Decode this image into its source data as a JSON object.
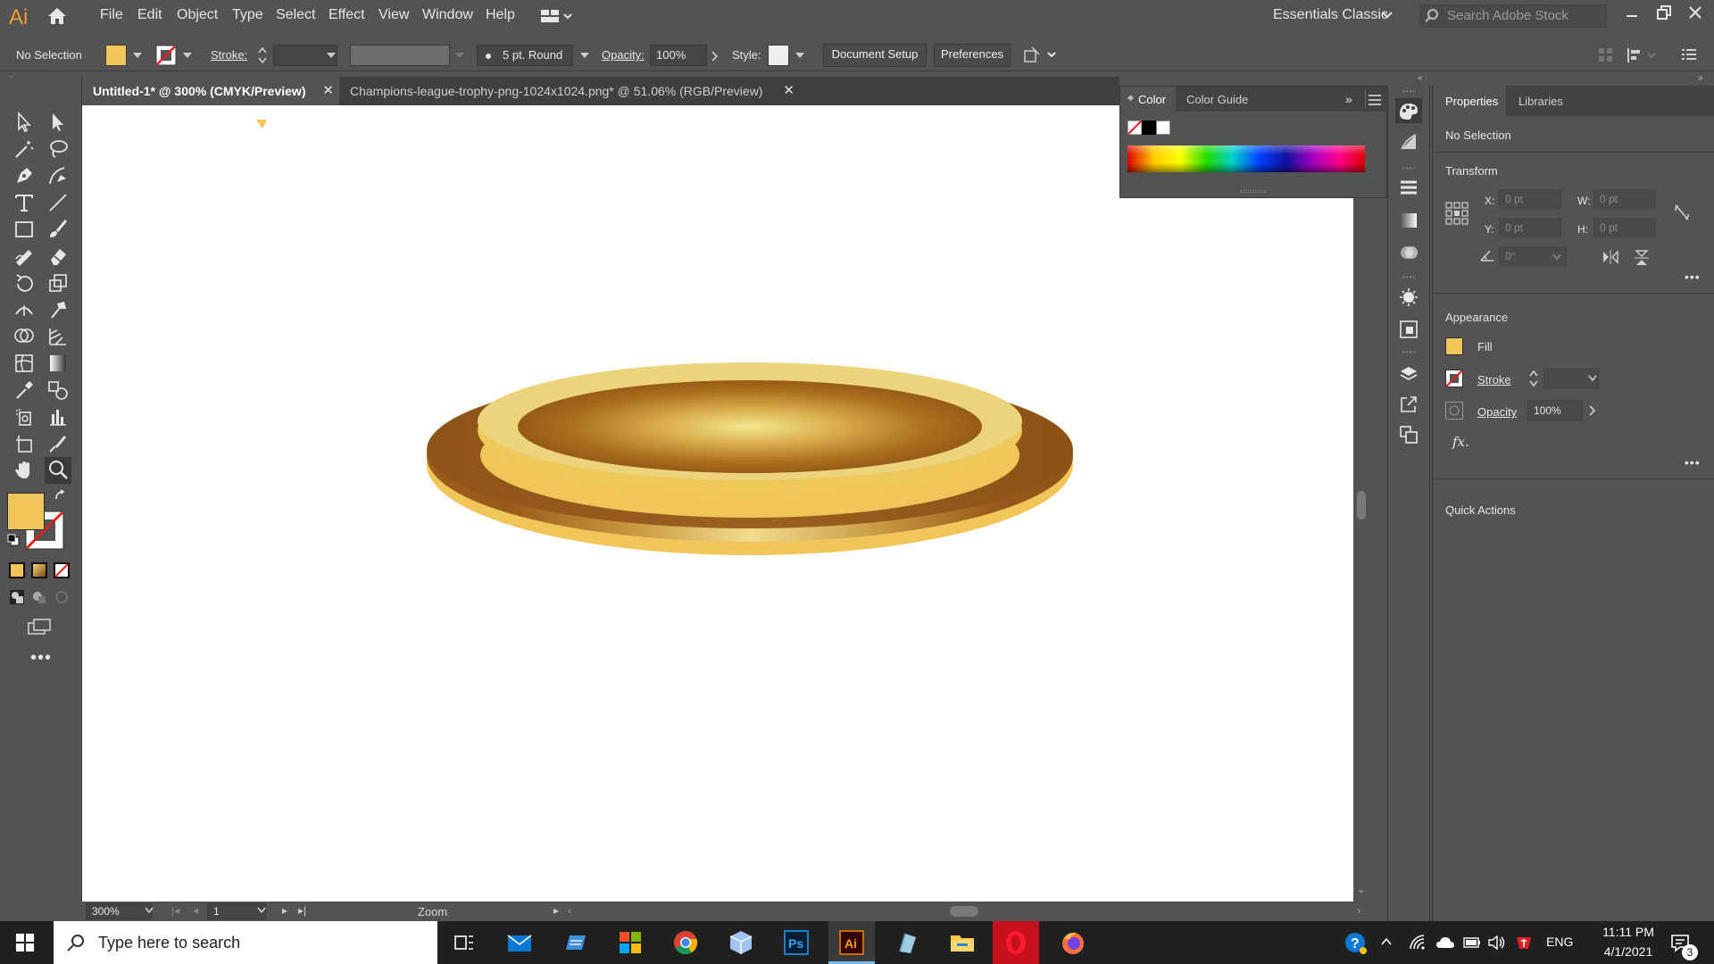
{
  "app": {
    "logo": "Ai"
  },
  "menu": [
    "File",
    "Edit",
    "Object",
    "Type",
    "Select",
    "Effect",
    "View",
    "Window",
    "Help"
  ],
  "workspace": "Essentials Classic",
  "search_stock": {
    "placeholder": "Search Adobe Stock"
  },
  "control": {
    "selection": "No Selection",
    "stroke_label": "Stroke:",
    "brush": "5 pt. Round",
    "opacity_label": "Opacity:",
    "opacity_value": "100%",
    "style_label": "Style:",
    "document_setup": "Document Setup",
    "preferences": "Preferences"
  },
  "tabs": [
    {
      "label": "Untitled-1* @ 300% (CMYK/Preview)",
      "close": "✕"
    },
    {
      "label": "Champions-league-trophy-png-1024x1024.png* @ 51.06% (RGB/Preview)",
      "close": "✕"
    }
  ],
  "status": {
    "zoom": "300%",
    "page": "1",
    "tool": "Zoom"
  },
  "color_panel": {
    "tab_color": "Color",
    "tab_guide": "Color Guide"
  },
  "properties": {
    "tab_properties": "Properties",
    "tab_libraries": "Libraries",
    "selection": "No Selection",
    "transform": "Transform",
    "x_label": "X:",
    "y_label": "Y:",
    "w_label": "W:",
    "h_label": "H:",
    "x": "0 pt",
    "y": "0 pt",
    "w": "0 pt",
    "h": "0 pt",
    "angle": "0°",
    "appearance": "Appearance",
    "fill": "Fill",
    "stroke": "Stroke",
    "opacity": "Opacity",
    "opacity_value": "100%",
    "fx": "fx.",
    "quick_actions": "Quick Actions"
  },
  "colors": {
    "fill": "#f0c55a",
    "accent": "#f29b26",
    "gold_dark": "#94581a",
    "gold_light": "#eed47a"
  },
  "taskbar": {
    "search": "Type here to search",
    "lang": "ENG",
    "time": "11:11 PM",
    "date": "4/1/2021",
    "notifications": "3"
  }
}
